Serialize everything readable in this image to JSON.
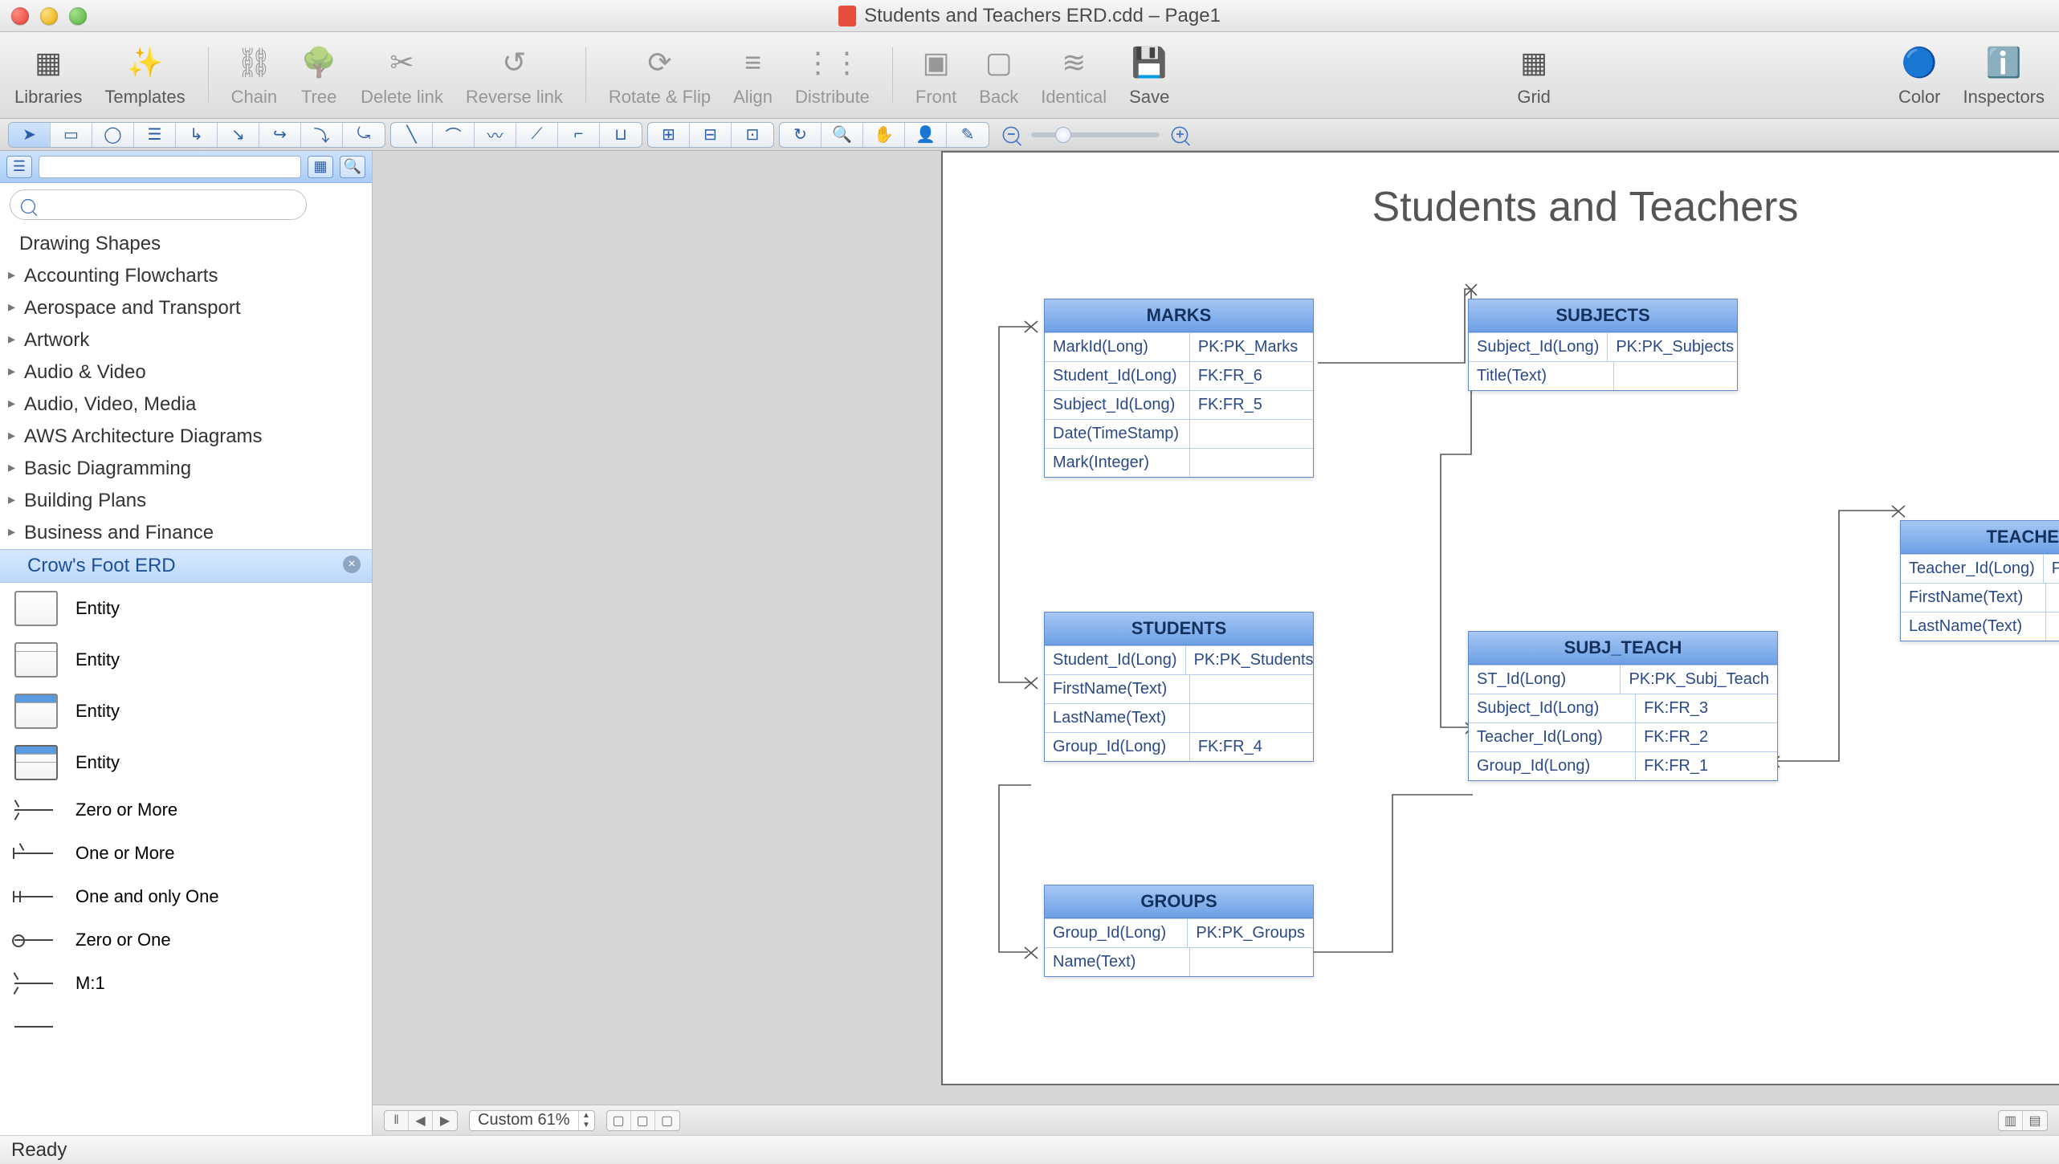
{
  "window": {
    "title": "Students and Teachers ERD.cdd – Page1"
  },
  "toolbar": {
    "libraries": "Libraries",
    "templates": "Templates",
    "chain": "Chain",
    "tree": "Tree",
    "delete_link": "Delete link",
    "reverse_link": "Reverse link",
    "rotate_flip": "Rotate & Flip",
    "align": "Align",
    "distribute": "Distribute",
    "front": "Front",
    "back": "Back",
    "identical": "Identical",
    "save": "Save",
    "grid": "Grid",
    "color": "Color",
    "inspectors": "Inspectors"
  },
  "sidebar": {
    "header": "Drawing Shapes",
    "categories": [
      "Accounting Flowcharts",
      "Aerospace and Transport",
      "Artwork",
      "Audio & Video",
      "Audio, Video, Media",
      "AWS Architecture Diagrams",
      "Basic Diagramming",
      "Building Plans",
      "Business and Finance"
    ],
    "active_library": "Crow's Foot ERD",
    "shapes": [
      "Entity",
      "Entity",
      "Entity",
      "Entity",
      "Zero or More",
      "One or More",
      "One and only One",
      "Zero or One",
      "M:1"
    ]
  },
  "canvas": {
    "title": "Students and Teachers",
    "entities": {
      "marks": {
        "name": "MARKS",
        "rows": [
          [
            "MarkId(Long)",
            "PK:PK_Marks"
          ],
          [
            "Student_Id(Long)",
            "FK:FR_6"
          ],
          [
            "Subject_Id(Long)",
            "FK:FR_5"
          ],
          [
            "Date(TimeStamp)",
            ""
          ],
          [
            "Mark(Integer)",
            ""
          ]
        ]
      },
      "subjects": {
        "name": "SUBJECTS",
        "rows": [
          [
            "Subject_Id(Long)",
            "PK:PK_Subjects"
          ],
          [
            "Title(Text)",
            ""
          ]
        ]
      },
      "students": {
        "name": "STUDENTS",
        "rows": [
          [
            "Student_Id(Long)",
            "PK:PK_Students"
          ],
          [
            "FirstName(Text)",
            ""
          ],
          [
            "LastName(Text)",
            ""
          ],
          [
            "Group_Id(Long)",
            "FK:FR_4"
          ]
        ]
      },
      "subj_teach": {
        "name": "SUBJ_TEACH",
        "rows": [
          [
            "ST_Id(Long)",
            "PK:PK_Subj_Teach"
          ],
          [
            "Subject_Id(Long)",
            "FK:FR_3"
          ],
          [
            "Teacher_Id(Long)",
            "FK:FR_2"
          ],
          [
            "Group_Id(Long)",
            "FK:FR_1"
          ]
        ]
      },
      "teachers": {
        "name": "TEACHERS",
        "rows": [
          [
            "Teacher_Id(Long)",
            "PK:PK_Teachers"
          ],
          [
            "FirstName(Text)",
            ""
          ],
          [
            "LastName(Text)",
            ""
          ]
        ]
      },
      "groups": {
        "name": "GROUPS",
        "rows": [
          [
            "Group_Id(Long)",
            "PK:PK_Groups"
          ],
          [
            "Name(Text)",
            ""
          ]
        ]
      }
    }
  },
  "bottombar": {
    "zoom": "Custom 61%"
  },
  "status": "Ready"
}
